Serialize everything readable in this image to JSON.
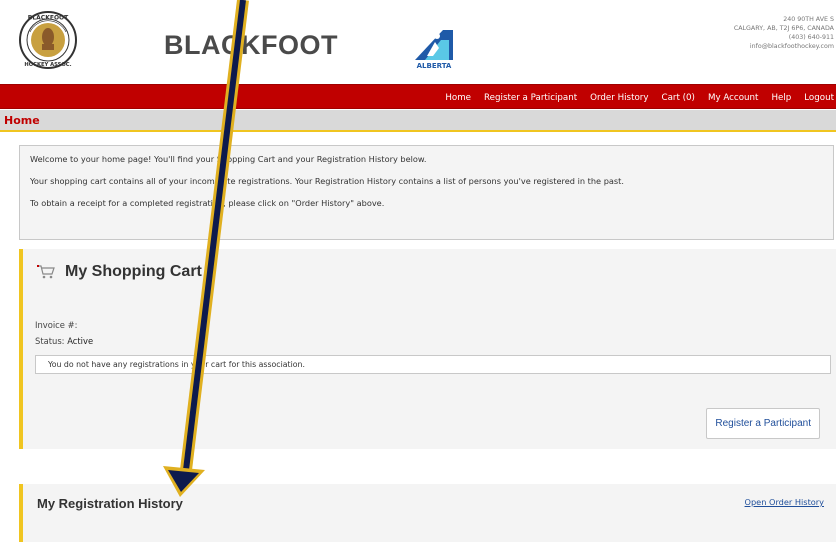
{
  "header": {
    "brand": "BLACKFOOT",
    "logo_text_top": "BLACKFOOT",
    "logo_text_bottom": "HOCKEY ASSOC.",
    "alberta_text": "ALBERTA",
    "address": [
      "240 90TH AVE S",
      "CALGARY, AB, T2J 6P6, CANADA",
      "(403) 640-911",
      "info@blackfoothockey.com"
    ]
  },
  "nav": {
    "items": [
      "Home",
      "Register a Participant",
      "Order History",
      "Cart (0)",
      "My Account",
      "Help",
      "Logout"
    ]
  },
  "breadcrumb": {
    "title": "Home"
  },
  "welcome": {
    "line1": "Welcome to your home page! You'll find your Shopping Cart and your Registration History below.",
    "line2": "Your shopping cart contains all of your incomplete registrations. Your Registration History contains a list of persons you've registered in the past.",
    "line3": "To obtain a receipt for a completed registration, please click on \"Order History\" above."
  },
  "cart": {
    "title": "My Shopping Cart",
    "invoice_label": "Invoice #:",
    "status_label": "Status:",
    "status_value": "Active",
    "empty_message": "You do not have any registrations in your cart for this association.",
    "register_button": "Register a Participant"
  },
  "history": {
    "title": "My Registration History",
    "link": "Open Order History"
  },
  "colors": {
    "nav_red": "#c00000",
    "accent_gold": "#f0c520",
    "arrow_navy": "#0d1a4d",
    "link_blue": "#1f4e9a"
  },
  "icons": {
    "cart": "shopping-cart-icon",
    "logo": "blackfoot-logo-icon",
    "alberta": "hockey-alberta-logo-icon",
    "arrow": "annotation-arrow-icon"
  }
}
